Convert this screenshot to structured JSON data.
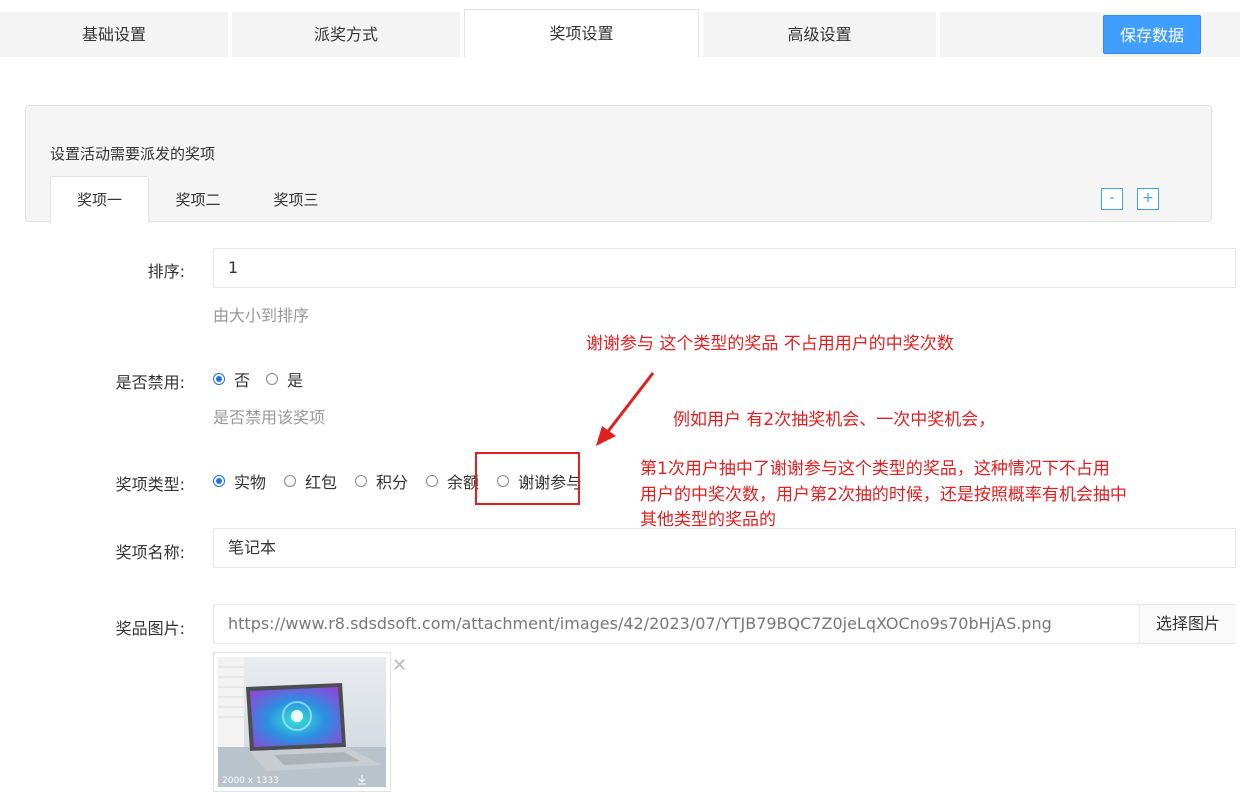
{
  "top_tabs": [
    "基础设置",
    "派奖方式",
    "奖项设置",
    "高级设置"
  ],
  "save_label": "保存数据",
  "panel": {
    "title": "设置活动需要派发的奖项",
    "tabs": [
      "奖项一",
      "奖项二",
      "奖项三"
    ],
    "minus": "-",
    "plus": "+"
  },
  "form": {
    "sort_label": "排序:",
    "sort_value": "1",
    "sort_hint": "由大小到排序",
    "disable_label": "是否禁用:",
    "disable_options": [
      "否",
      "是"
    ],
    "disable_hint": "是否禁用该奖项",
    "type_label": "奖项类型:",
    "type_options": [
      "实物",
      "红包",
      "积分",
      "余额",
      "谢谢参与"
    ],
    "name_label": "奖项名称:",
    "name_value": "笔记本",
    "image_label": "奖品图片:",
    "image_url": "https://www.r8.sdsdsoft.com/attachment/images/42/2023/07/YTJB79BQC7Z0jeLqXOCno9s70bHjAS.png",
    "choose_image": "选择图片",
    "thumb_caption": "2000 x 1333",
    "thumb_close": "✕"
  },
  "annotations": {
    "note1": "谢谢参与 这个类型的奖品 不占用用户的中奖次数",
    "note2": "例如用户 有2次抽奖机会、一次中奖机会，",
    "note3_lines": [
      "第1次用户抽中了谢谢参与这个类型的奖品，这种情况下不占用",
      "用户的中奖次数，用户第2次抽的时候，还是按照概率有机会抽中",
      "其他类型的奖品的"
    ]
  }
}
